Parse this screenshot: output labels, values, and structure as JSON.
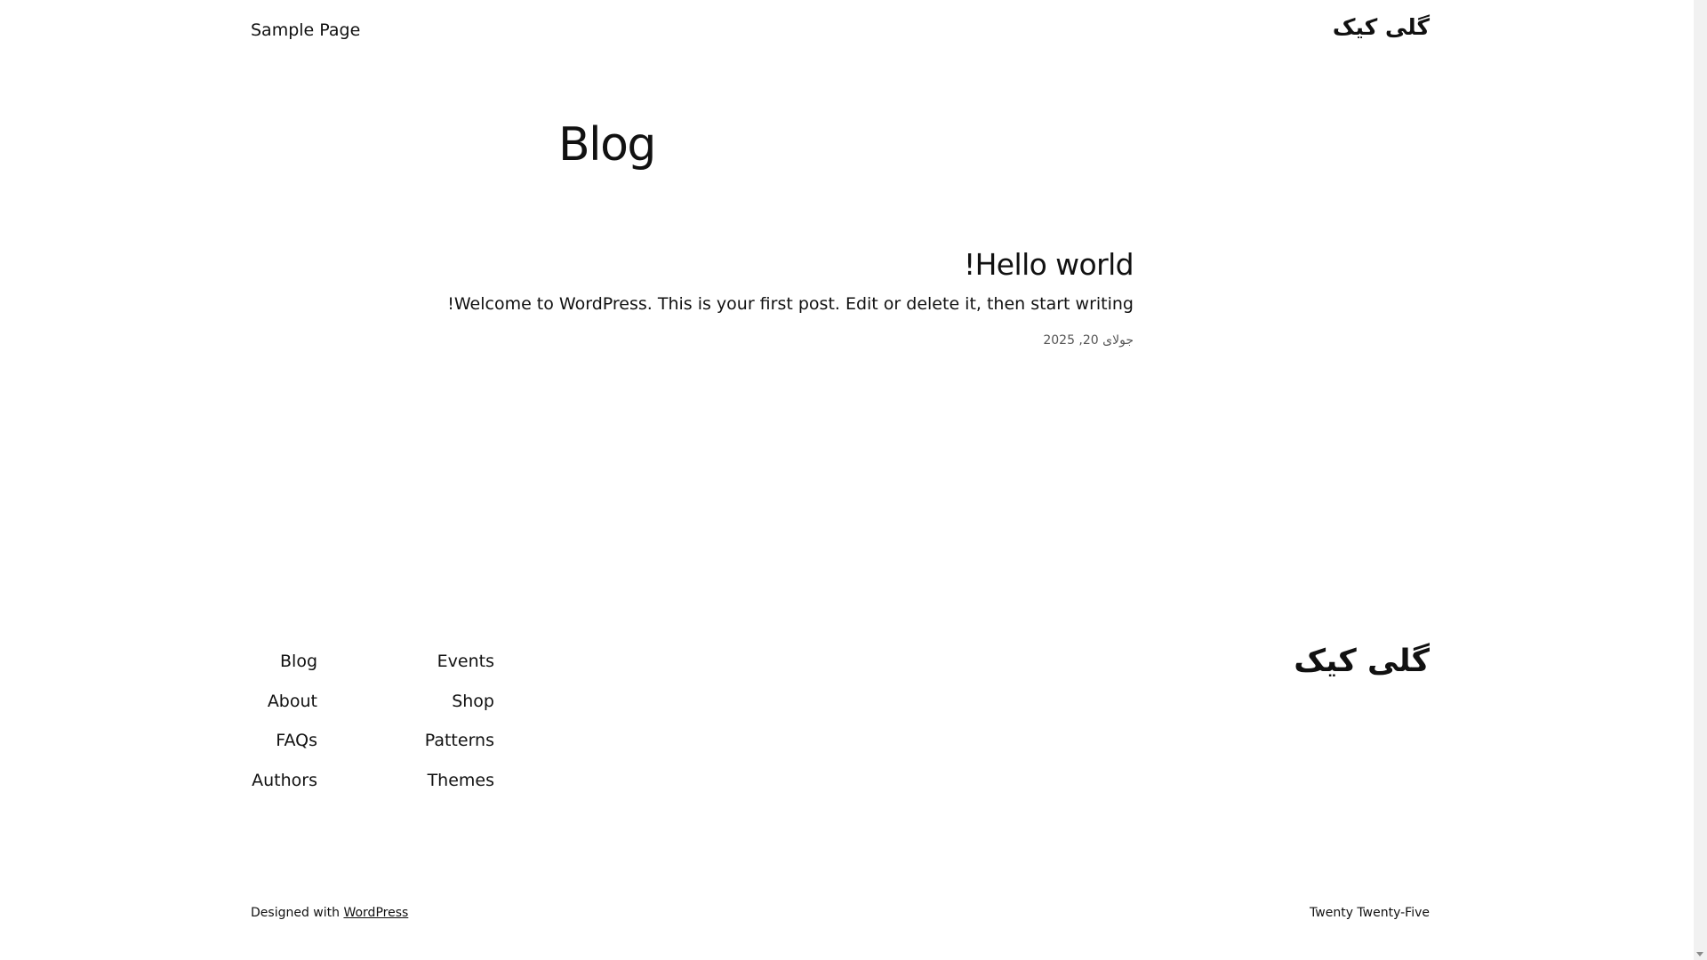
{
  "header": {
    "site_title": "گلی کیک",
    "nav": [
      "Sample Page"
    ]
  },
  "main": {
    "page_title": "Blog",
    "posts": [
      {
        "title": "Hello world!",
        "excerpt": "Welcome to WordPress. This is your first post. Edit or delete it, then start writing!",
        "date": "جولای 20, 2025"
      }
    ]
  },
  "footer": {
    "nav_col1": [
      "Blog",
      "About",
      "FAQs",
      "Authors"
    ],
    "nav_col2": [
      "Events",
      "Shop",
      "Patterns",
      "Themes"
    ],
    "site_title": "گلی کیک",
    "credit_prefix": "Designed with ",
    "credit_link": "WordPress",
    "theme_name": "Twenty Twenty-Five"
  }
}
